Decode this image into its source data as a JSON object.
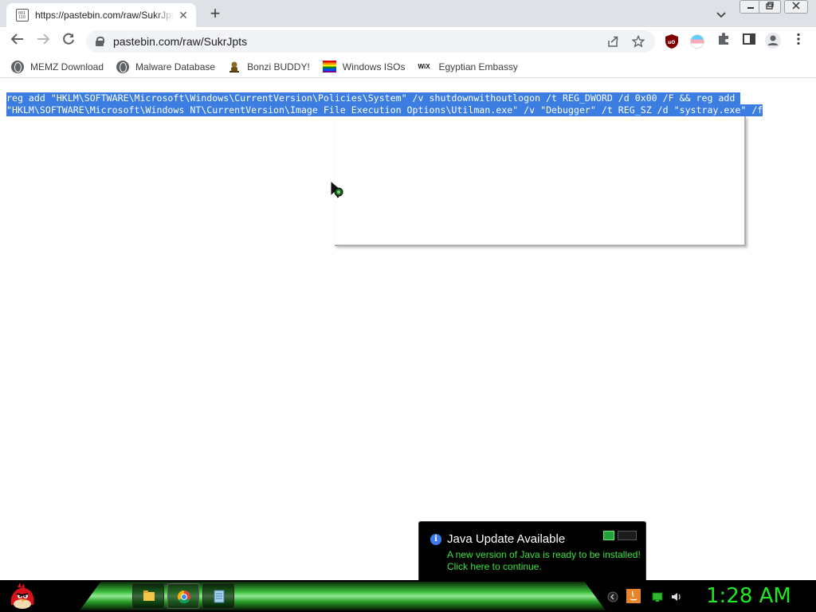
{
  "browser": {
    "tab_title": "https://pastebin.com/raw/SukrJpts",
    "tab_close": "✕",
    "new_tab": "+",
    "url": "pastebin.com/raw/SukrJpts"
  },
  "bookmarks": [
    {
      "label": "MEMZ Download",
      "icon": "globe-icon"
    },
    {
      "label": "Malware Database",
      "icon": "globe-icon"
    },
    {
      "label": "Bonzi BUDDY!",
      "icon": "bonzi-icon"
    },
    {
      "label": "Windows ISOs",
      "icon": "rainbow-icon"
    },
    {
      "label": "Egyptian Embassy",
      "icon": "wix-icon"
    }
  ],
  "bookmark_wix_glyph": "WiX",
  "content": {
    "line1": "reg add \"HKLM\\SOFTWARE\\Microsoft\\Windows\\CurrentVersion\\Policies\\System\" /v shutdownwithoutlogon /t REG_DWORD /d 0x00 /F && reg add ",
    "line2": "\"HKLM\\SOFTWARE\\Microsoft\\Windows NT\\CurrentVersion\\Image File Execution Options\\Utilman.exe\" /v \"Debugger\" /t REG_SZ /d \"systray.exe\" /f"
  },
  "notification": {
    "title": "Java Update Available",
    "line1": "A new version of Java is ready to be installed!",
    "line2": "Click here to continue.",
    "info_glyph": "i"
  },
  "taskbar": {
    "clock": "1:28 AM"
  },
  "colors": {
    "selection": "#3b7de0",
    "clock": "#21e621",
    "java_text": "#39e33f"
  }
}
